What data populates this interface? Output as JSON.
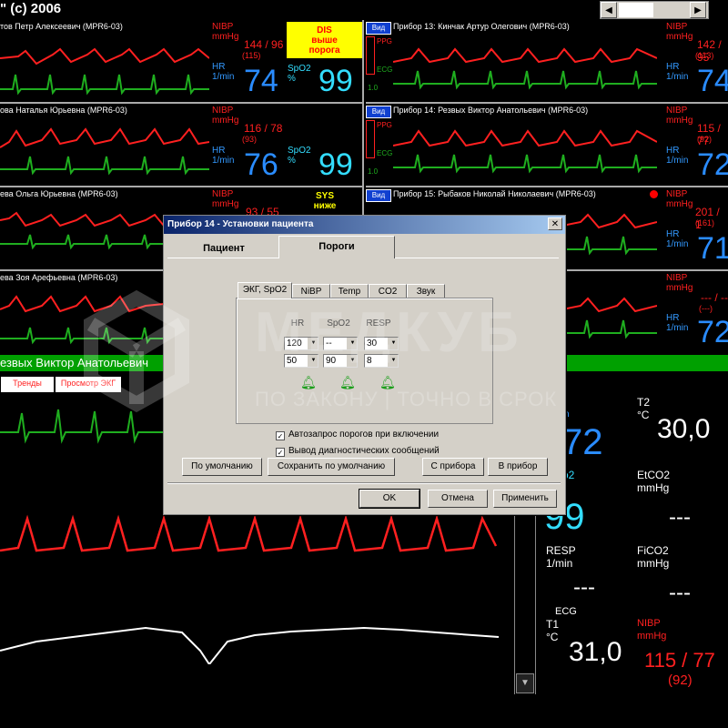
{
  "app": {
    "title": "\" (c) 2006"
  },
  "panels": [
    {
      "name": "тов Петр Алексеевич (MPR6-03)",
      "nibp": "144 / 96",
      "nibp_sub": "(115)",
      "hr": "74",
      "spo2": "99",
      "alarm": [
        "DIS",
        "выше",
        "порога"
      ]
    },
    {
      "name": "ова Наталья Юрьевна (MPR6-03)",
      "nibp": "116 / 78",
      "nibp_sub": "(93)",
      "hr": "76",
      "spo2": "99"
    },
    {
      "name": "ева Ольга Юрьевна (MPR6-03)",
      "nibp": "93 / 55",
      "alarm": [
        "SYS",
        "ниже"
      ]
    },
    {
      "name": "ева Зоя Арефьевна (MPR6-03)"
    }
  ],
  "right_panels": [
    {
      "vid": "Вид",
      "name": "Прибор 13: Кинчак Артур Олегович (MPR6-03)",
      "nibp": "142 / 95",
      "nibp_sub": "(113)",
      "hr": "74"
    },
    {
      "vid": "Вид",
      "name": "Прибор 14: Резвых Виктор Анатольевич (MPR6-03)",
      "nibp": "115 / 77",
      "nibp_sub": "(92)",
      "hr": "72"
    },
    {
      "vid": "Вид",
      "name": "Прибор 15: Рыбаков Николай Николаевич (MPR6-03)",
      "nibp": "201 / 1",
      "nibp_sub": "(161)",
      "hr": "71"
    },
    {
      "nibp": "--- / --",
      "nibp_sub": "(---)",
      "hr": "72"
    }
  ],
  "labels": {
    "nibp": "NIBP",
    "mmhg": "mmHg",
    "hr": "HR",
    "per_min": "1/min",
    "spo2": "SpO2",
    "pct": "%",
    "ppg": "PPG",
    "ecg": "ECG",
    "scale": "1.0"
  },
  "detail": {
    "patient_name": "езвых Виктор Анатольевич",
    "tab_trends": "Тренды",
    "tab_view_ecg": "Просмотр ЭКГ",
    "t2_label": "T2",
    "t2_unit": "°C",
    "t2_value": "30,0",
    "hr_partial": "72",
    "spo2_partial": "o2",
    "spo2_value": "99",
    "etco2_label": "EtCO2",
    "etco2_unit": "mmHg",
    "etco2_value": "---",
    "resp_label": "RESP",
    "resp_unit": "1/min",
    "resp_value": "---",
    "fico2_label": "FiCO2",
    "fico2_unit": "mmHg",
    "fico2_value": "---",
    "ecg_label": "ECG",
    "t1_label": "T1",
    "t1_unit": "°C",
    "t1_value": "31,0",
    "nibp_label": "NIBP",
    "nibp_unit": "mmHg",
    "nibp_value": "115 / 77",
    "nibp_sub": "(92)"
  },
  "dialog": {
    "title": "Прибор 14 - Установки пациента",
    "tab_patient": "Пациент",
    "tab_thresholds": "Пороги",
    "subtabs": [
      "ЭКГ, SpO2",
      "NiBP",
      "Temp",
      "CO2",
      "Звук"
    ],
    "col_hr": "HR",
    "col_spo2": "SpO2",
    "col_resp": "RESP",
    "hr_high": "120",
    "hr_low": "50",
    "spo2_high": "--",
    "spo2_low": "90",
    "resp_high": "30",
    "resp_low": "8",
    "check_auto": "Автозапрос порогов при включении",
    "check_diag": "Вывод диагностических сообщений",
    "btn_default": "По умолчанию",
    "btn_save_default": "Сохранить по умолчанию",
    "btn_from_device": "С прибора",
    "btn_to_device": "В прибор",
    "btn_ok": "OK",
    "btn_cancel": "Отмена",
    "btn_apply": "Применить"
  },
  "watermark": {
    "brand": "МЕДКУБ",
    "slogan": "ПО ЗАКОНУ | ТОЧНО В СРОК"
  },
  "colors": {
    "ecg": "#1fae1f",
    "ppg": "#ff2020",
    "hr": "#2a8cff",
    "spo2": "#33ddff",
    "alarm_bg": "#ffff00"
  }
}
